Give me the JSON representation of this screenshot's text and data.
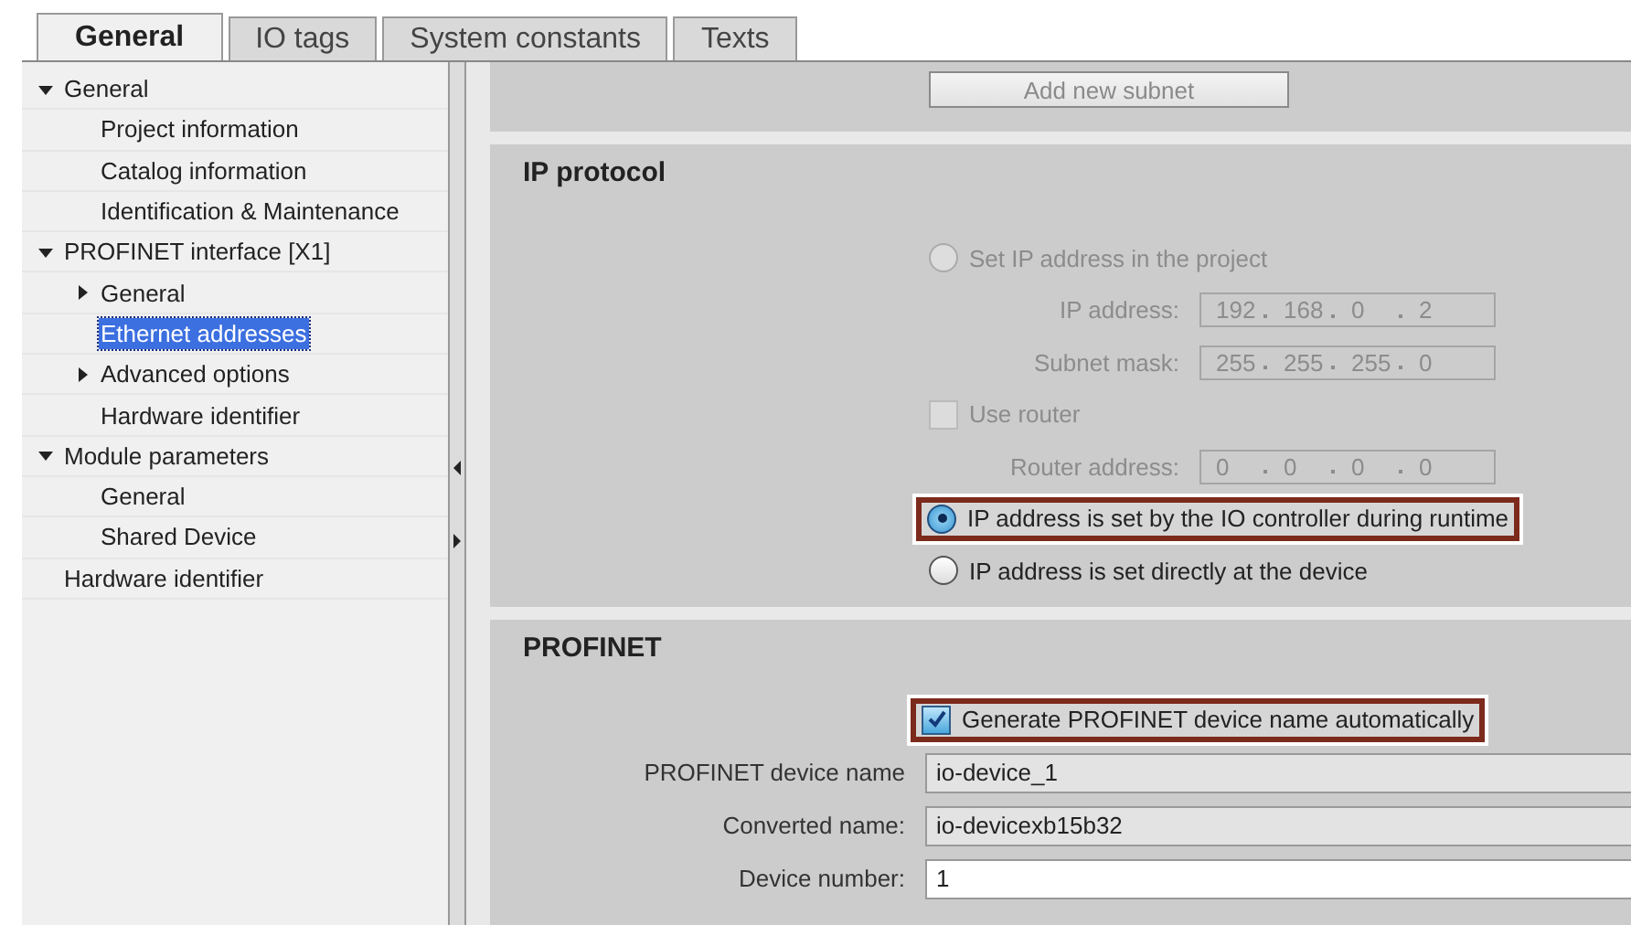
{
  "tabs": [
    {
      "label": "General",
      "selected": true
    },
    {
      "label": "IO tags",
      "selected": false
    },
    {
      "label": "System constants",
      "selected": false
    },
    {
      "label": "Texts",
      "selected": false
    }
  ],
  "tree": [
    {
      "label": "General",
      "expanded": true,
      "selected": false,
      "children": [
        {
          "label": "Project information",
          "selected": false
        },
        {
          "label": "Catalog information",
          "selected": false
        },
        {
          "label": "Identification & Maintenance",
          "selected": false
        }
      ]
    },
    {
      "label": "PROFINET interface [X1]",
      "expanded": true,
      "selected": false,
      "children": [
        {
          "label": "General",
          "expanded": false,
          "selected": false
        },
        {
          "label": "Ethernet addresses",
          "selected": true
        },
        {
          "label": "Advanced options",
          "expanded": false,
          "selected": false
        },
        {
          "label": "Hardware identifier",
          "selected": false
        }
      ]
    },
    {
      "label": "Module parameters",
      "expanded": true,
      "selected": false,
      "children": [
        {
          "label": "General",
          "selected": false
        },
        {
          "label": "Shared Device",
          "selected": false
        }
      ]
    },
    {
      "label": "Hardware identifier",
      "selected": false
    }
  ],
  "subnet": {
    "button": "Add new subnet",
    "disabled": true
  },
  "ip_protocol": {
    "title": "IP protocol",
    "rows": [
      {
        "kind": "radio",
        "label": "Set IP address in the project",
        "selected": false,
        "disabled": true,
        "highlighted": false
      },
      {
        "kind": "address",
        "label": "IP address:",
        "octets": [
          "192",
          "168",
          "0",
          "2"
        ],
        "disabled": true
      },
      {
        "kind": "address",
        "label": "Subnet mask:",
        "octets": [
          "255",
          "255",
          "255",
          "0"
        ],
        "disabled": true
      },
      {
        "kind": "checkbox",
        "label": "Use router",
        "checked": false,
        "disabled": true,
        "highlighted": false
      },
      {
        "kind": "address",
        "label": "Router address:",
        "octets": [
          "0",
          "0",
          "0",
          "0"
        ],
        "disabled": true
      },
      {
        "kind": "radio",
        "label": "IP address is set by the IO controller during runtime",
        "selected": true,
        "disabled": false,
        "highlighted": true
      },
      {
        "kind": "radio",
        "label": "IP address is set directly at the device",
        "selected": false,
        "disabled": false,
        "highlighted": false
      }
    ]
  },
  "profinet": {
    "title": "PROFINET",
    "rows": [
      {
        "kind": "checkbox",
        "label": "Generate PROFINET device name automatically",
        "checked": true,
        "disabled": false,
        "highlighted": true
      },
      {
        "kind": "text",
        "label": "PROFINET device name",
        "value": "io-device_1",
        "readonly": true
      },
      {
        "kind": "text",
        "label": "Converted name:",
        "value": "io-devicexb15b32",
        "readonly": true
      },
      {
        "kind": "text",
        "label": "Device number:",
        "value": "1",
        "readonly": false
      }
    ]
  }
}
